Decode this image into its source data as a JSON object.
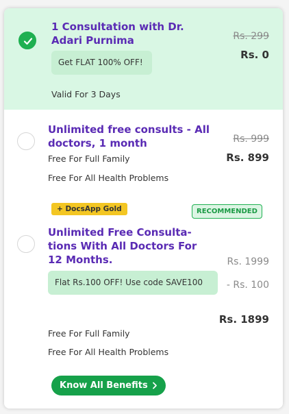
{
  "plans": [
    {
      "title": "1 Consultation with Dr. Adari Purnima",
      "offer": "Get FLAT 100% OFF!",
      "validity": "Valid For 3 Days",
      "original_price": "Rs. 299",
      "final_price": "Rs. 0",
      "selected": true
    },
    {
      "title": "Unlimited free consults - All doctors, 1 month",
      "features": [
        "Free For Full Family",
        "Free For All Health Problems"
      ],
      "original_price": "Rs. 999",
      "final_price": "Rs. 899",
      "selected": false
    },
    {
      "badge": "+ DocsApp Gold",
      "recommended": "RECOMMENDED",
      "title": "Unlimited Free Consulta-tions With All Doctors For 12 Months.",
      "offer": "Flat Rs.100 OFF! Use code SAVE100",
      "price": "Rs. 1999",
      "discount": "- Rs. 100",
      "final_price": "Rs. 1899",
      "features": [
        "Free For Full Family",
        "Free For All Health Problems"
      ],
      "cta": "Know All Benefits",
      "selected": false
    }
  ],
  "colors": {
    "selected_bg": "#d9f7e4",
    "title_purple": "#5a2bb4",
    "green": "#1fb051",
    "gold": "#f3c623"
  },
  "icons": [
    "check-icon",
    "chevron-right-icon"
  ]
}
